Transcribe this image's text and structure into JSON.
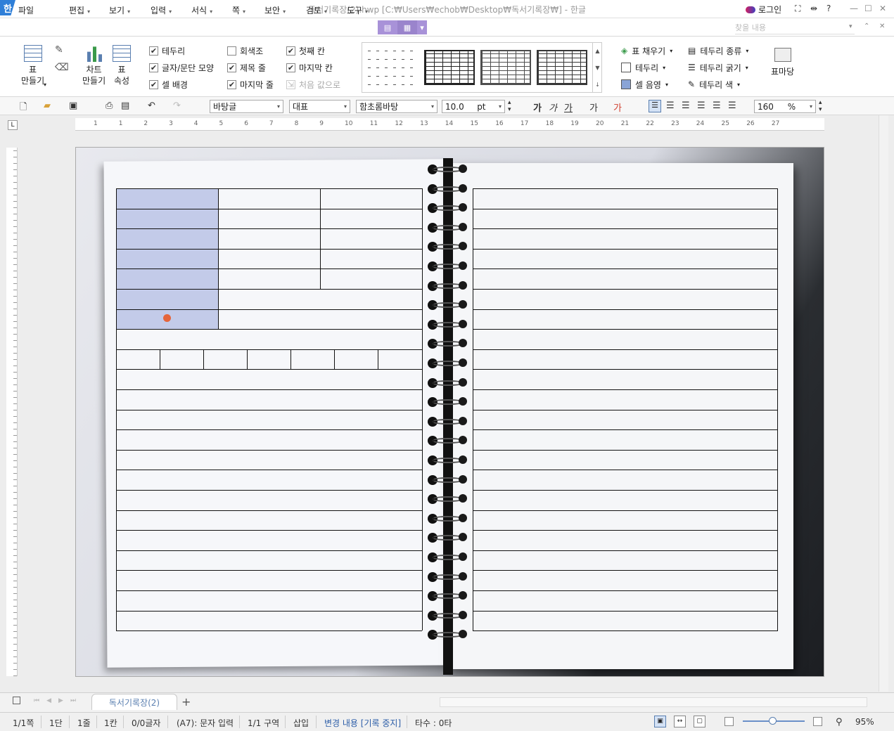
{
  "titlebar": {
    "logo": "한",
    "title": "독서기록장(2).hwp [C:₩Users₩echob₩Desktop₩독서기록장₩] - 한글",
    "login": "로그인",
    "help": "?"
  },
  "menu": {
    "items": [
      "파일",
      "편집",
      "보기",
      "입력",
      "서식",
      "쪽",
      "보안",
      "검토",
      "도구"
    ],
    "search_placeholder": "찾을 내용"
  },
  "ribbon": {
    "table_make": [
      "표",
      "만들기"
    ],
    "chart_make": [
      "차트",
      "만들기"
    ],
    "table_props": [
      "표",
      "속성"
    ],
    "checks_col1": [
      {
        "label": "테두리",
        "checked": true
      },
      {
        "label": "글자/문단 모양",
        "checked": true
      },
      {
        "label": "셀 배경",
        "checked": true
      }
    ],
    "checks_col2": [
      {
        "label": "회색조",
        "checked": false
      },
      {
        "label": "제목 줄",
        "checked": true
      },
      {
        "label": "마지막 줄",
        "checked": true
      }
    ],
    "checks_col3": [
      {
        "label": "첫째 칸",
        "checked": true
      },
      {
        "label": "마지막 칸",
        "checked": true
      }
    ],
    "reset_label": "처음 값으로",
    "right_col1": [
      "표 채우기",
      "테두리",
      "셀 음영"
    ],
    "right_col2": [
      "테두리 종류",
      "테두리 굵기",
      "테두리 색"
    ],
    "madang": "표마당"
  },
  "format": {
    "style": "바탕글",
    "lang": "대표",
    "font": "함초롬바탕",
    "size": "10.0",
    "unit": "pt",
    "zoom": "160",
    "zoom_unit": "%",
    "bold": "가",
    "italic": "가",
    "underline": "가",
    "strike": "가",
    "outline": "가"
  },
  "ruler": {
    "h_ticks": [
      "1",
      "1",
      "2",
      "3",
      "4",
      "5",
      "6",
      "7",
      "8",
      "9",
      "10",
      "11",
      "12",
      "13",
      "14",
      "15",
      "16",
      "17",
      "18",
      "19",
      "20",
      "21",
      "22",
      "23",
      "24",
      "25",
      "26",
      "27"
    ]
  },
  "tabs": {
    "doc": "독서기록장(2)",
    "add": "+"
  },
  "status": {
    "page": "1/1쪽",
    "col": "1단",
    "line": "1줄",
    "kan": "1칸",
    "chars": "0/0글자",
    "cell": "(A7): 문자 입력",
    "section": "1/1 구역",
    "insert": "삽입",
    "track": "변경 내용 [기록 중지]",
    "typing": "타수 : 0타",
    "zoom": "95%"
  }
}
